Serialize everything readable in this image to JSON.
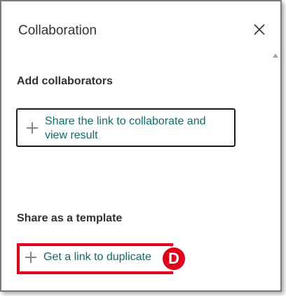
{
  "panel": {
    "title": "Collaboration",
    "close_icon": "close-icon"
  },
  "collaborators": {
    "heading": "Add collaborators",
    "share_link_label": "Share the link to collaborate and view result",
    "icon": "plus-icon"
  },
  "template": {
    "heading": "Share as a template",
    "duplicate_link_label": "Get a link to duplicate",
    "icon": "plus-icon"
  },
  "annotation": {
    "badge_label": "D",
    "highlight_color": "#e0001b"
  },
  "colors": {
    "link_text": "#0f6b6b",
    "heading_text": "#323130"
  }
}
